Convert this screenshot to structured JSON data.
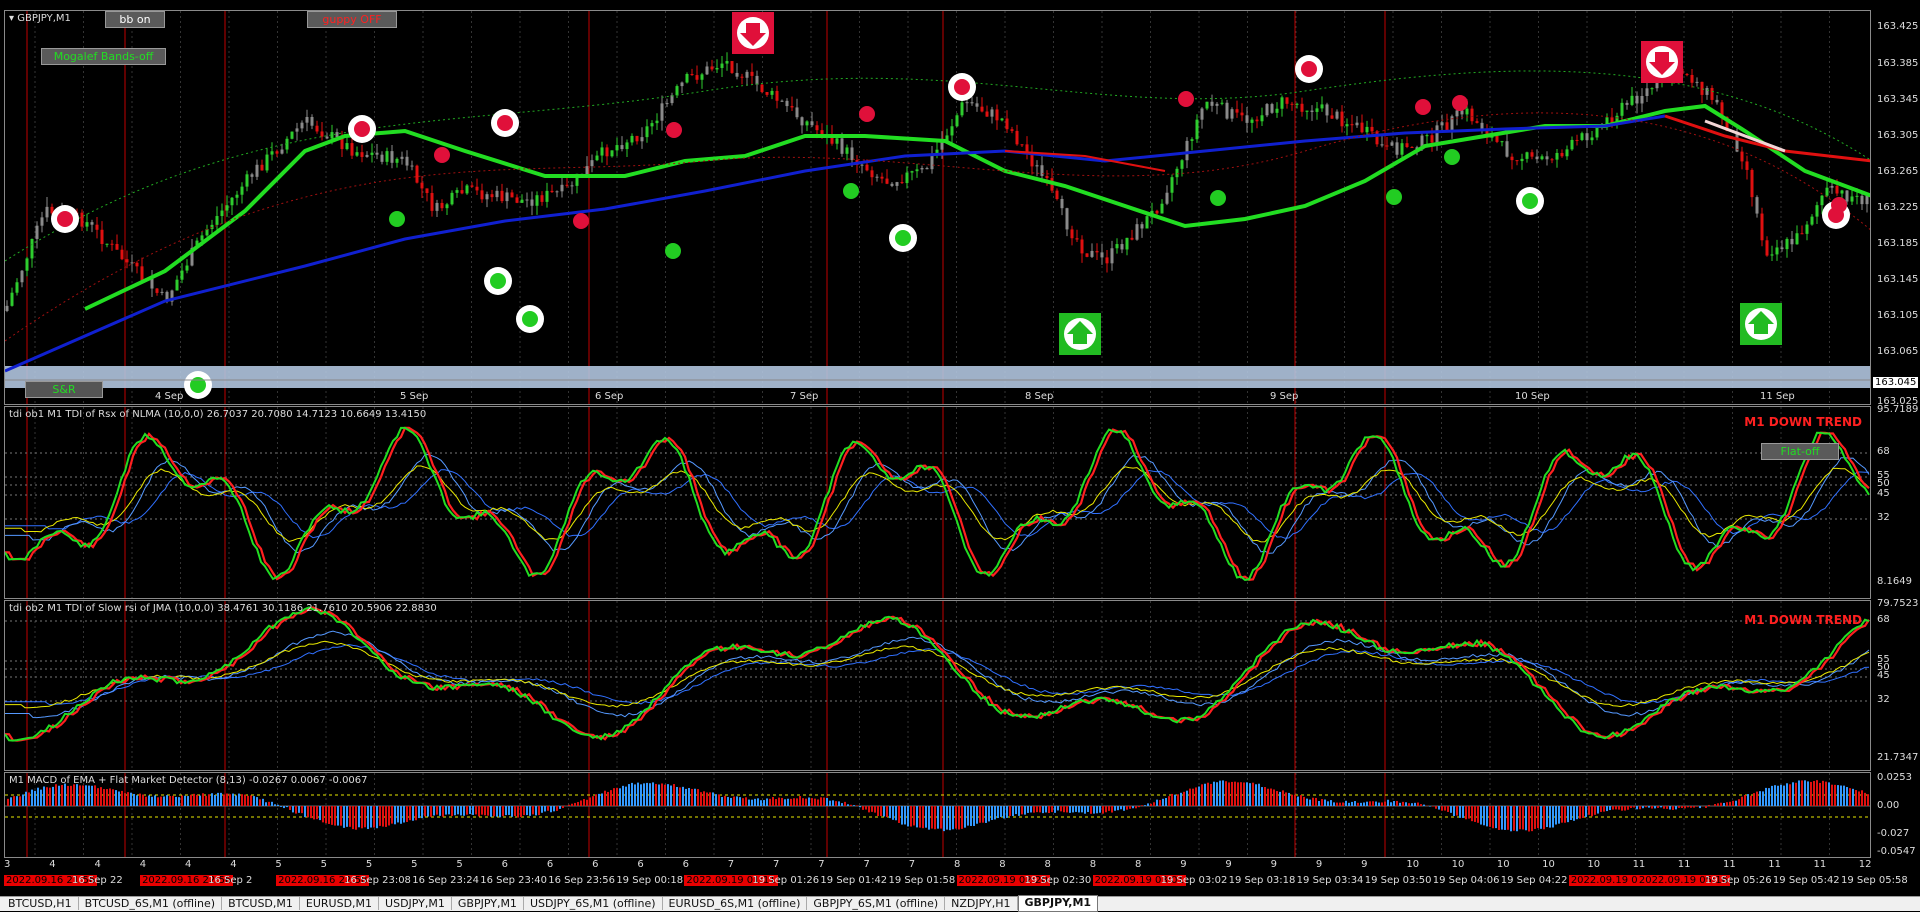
{
  "symbol_title": "GBPJPY,M1",
  "buttons": {
    "bb": "bb on",
    "guppy": "guppy OFF",
    "mogalef": "Mogalef Bands-off",
    "sr": "S&R",
    "flat": "Flat-off"
  },
  "main_price_scale": [
    "163.425",
    "163.385",
    "163.345",
    "163.305",
    "163.265",
    "163.225",
    "163.185",
    "163.145",
    "163.105",
    "163.065",
    "163.045",
    "163.025"
  ],
  "current_price": "163.045",
  "day_labels": [
    "4 Sep",
    "5 Sep",
    "6 Sep",
    "7 Sep",
    "8 Sep",
    "9 Sep",
    "10 Sep",
    "11 Sep"
  ],
  "tdi1": {
    "title": "tdi ob1 M1 TDI of Rsx of NLMA (10,0,0) 26.7037 20.7080 14.7123 10.6649 13.4150",
    "trend": "M1 DOWN TREND",
    "scale": [
      "95.7189",
      "68",
      "55",
      "50",
      "45",
      "32",
      "8.1649"
    ]
  },
  "tdi2": {
    "title": "tdi ob2 M1 TDI of Slow rsi of JMA (10,0,0) 38.4761 30.1186 21.7610 20.5906 22.8830",
    "trend": "M1 DOWN TREND",
    "scale": [
      "79.7523",
      "68",
      "55",
      "50",
      "45",
      "32",
      "21.7347"
    ]
  },
  "macd": {
    "title": "M1 MACD of EMA + Flat Market Detector (8,13) -0.0267 0.0067 -0.0067",
    "scale": [
      "0.0253",
      "0.00",
      "-0.027",
      "-0.0547"
    ]
  },
  "number_row": [
    "3",
    "4",
    "4",
    "4",
    "4",
    "4",
    "5",
    "5",
    "5",
    "5",
    "5",
    "6",
    "6",
    "6",
    "6",
    "6",
    "7",
    "7",
    "7",
    "7",
    "7",
    "8",
    "8",
    "8",
    "8",
    "8",
    "9",
    "9",
    "9",
    "9",
    "9",
    "10",
    "10",
    "10",
    "10",
    "10",
    "11",
    "11",
    "11",
    "11",
    "11",
    "12"
  ],
  "time_labels": [
    {
      "t": "2022.09.16 21:56",
      "hl": true
    },
    {
      "t": "16 Sep 22",
      "hl": false
    },
    {
      "t": "2022.09.16 22:56",
      "hl": true
    },
    {
      "t": "16 Sep 2",
      "hl": false
    },
    {
      "t": "2022.09.16 22:58",
      "hl": true
    },
    {
      "t": "16 Sep 23:08",
      "hl": false
    },
    {
      "t": "16 Sep 23:24",
      "hl": false
    },
    {
      "t": "16 Sep 23:40",
      "hl": false
    },
    {
      "t": "16 Sep 23:56",
      "hl": false
    },
    {
      "t": "19 Sep 00:18",
      "hl": false
    },
    {
      "t": "2022.09.19 01:11",
      "hl": true
    },
    {
      "t": "19 Sep 01:26",
      "hl": false
    },
    {
      "t": "19 Sep 01:42",
      "hl": false
    },
    {
      "t": "19 Sep 01:58",
      "hl": false
    },
    {
      "t": "2022.09.19 02:20",
      "hl": true
    },
    {
      "t": "19 Sep 02:30",
      "hl": false
    },
    {
      "t": "2022.09.19 03:01",
      "hl": true
    },
    {
      "t": "19 Sep 03:02",
      "hl": false
    },
    {
      "t": "19 Sep 03:18",
      "hl": false
    },
    {
      "t": "19 Sep 03:34",
      "hl": false
    },
    {
      "t": "19 Sep 03:50",
      "hl": false
    },
    {
      "t": "19 Sep 04:06",
      "hl": false
    },
    {
      "t": "19 Sep 04:22",
      "hl": false
    },
    {
      "t": "2022.09.19 04:48",
      "hl": true
    },
    {
      "t": "2022.09.19 05:16",
      "hl": true
    },
    {
      "t": "19 Sep 05:26",
      "hl": false
    },
    {
      "t": "19 Sep 05:42",
      "hl": false
    },
    {
      "t": "19 Sep 05:58",
      "hl": false
    }
  ],
  "tabs": [
    "BTCUSD,H1",
    "BTCUSD_6S,M1 (offline)",
    "BTCUSD,M1",
    "EURUSD,M1",
    "USDJPY,M1",
    "GBPJPY,M1",
    "USDJPY_6S,M1 (offline)",
    "EURUSD_6S,M1 (offline)",
    "GBPJPY_6S,M1 (offline)",
    "NZDJPY,H1",
    "GBPJPY,M1"
  ],
  "active_tab": "GBPJPY,M1",
  "colors": {
    "bull": "#2ecc2e",
    "bear": "#e01010",
    "neutral": "#8a8a8a",
    "ma_green": "#22dd22",
    "ma_blue": "#1020d0",
    "ma_red": "#e01010",
    "vline": "#c00000",
    "macd_blue": "#3399ff",
    "macd_red": "#e01010"
  }
}
